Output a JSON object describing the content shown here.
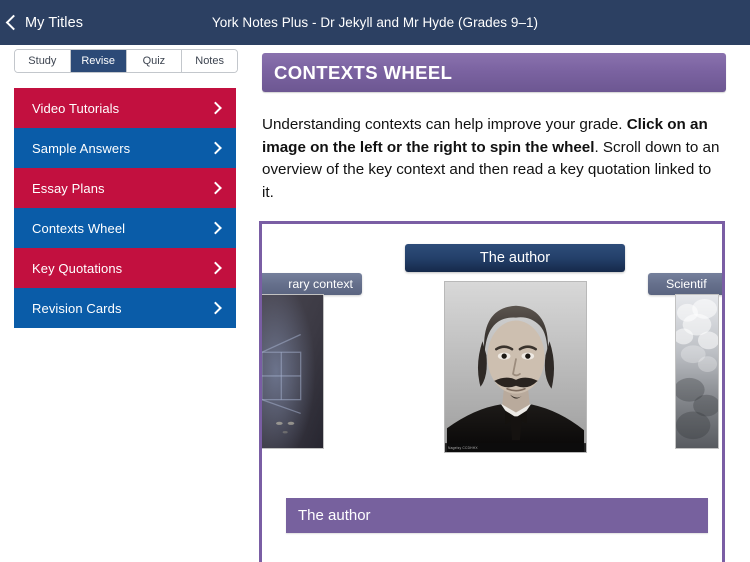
{
  "topbar": {
    "back_label": "My Titles",
    "back_icon": "chevron-left-icon",
    "title": "York Notes Plus - Dr Jekyll and Mr Hyde (Grades 9–1)",
    "background_color": "#2c4062"
  },
  "tabs": {
    "items": [
      {
        "label": "Study",
        "active": false
      },
      {
        "label": "Revise",
        "active": true
      },
      {
        "label": "Quiz",
        "active": false
      },
      {
        "label": "Notes",
        "active": false
      }
    ],
    "active_color": "#2c4a77"
  },
  "sidebar": {
    "items": [
      {
        "label": "Video Tutorials",
        "color": "#c2103f",
        "chevron": "chevron-right-icon"
      },
      {
        "label": "Sample Answers",
        "color": "#0a5ca8",
        "chevron": "chevron-right-icon"
      },
      {
        "label": "Essay Plans",
        "color": "#c2103f",
        "chevron": "chevron-right-icon"
      },
      {
        "label": "Contexts Wheel",
        "color": "#0a5ca8",
        "chevron": "chevron-right-icon"
      },
      {
        "label": "Key Quotations",
        "color": "#c2103f",
        "chevron": "chevron-right-icon"
      },
      {
        "label": "Revision Cards",
        "color": "#0a5ca8",
        "chevron": "chevron-right-icon"
      }
    ]
  },
  "content": {
    "header_title": "CONTEXTS WHEEL",
    "header_color": "#7b63a1",
    "intro": {
      "part1": "Understanding contexts can help improve your grade. ",
      "bold": "Click on an image on the left or the right to spin the wheel",
      "part2": ". Scroll down to an overview of the key context and then read a key quotation linked to it."
    }
  },
  "wheel": {
    "border_color": "#7a5ea4",
    "center": {
      "title": "The author",
      "image_alt": "portrait-of-robert-louis-stevenson",
      "image_caption": "Nagelsy  CCDHHX"
    },
    "left": {
      "label": "rary context",
      "full_label": "Literary context",
      "image_alt": "dark-window-silhouette-thumbnail"
    },
    "right": {
      "label": "Scientif",
      "full_label": "Scientific context",
      "image_alt": "smoke-clouds-thumbnail"
    },
    "section_bar": {
      "label": "The author",
      "color": "#77619e"
    }
  }
}
